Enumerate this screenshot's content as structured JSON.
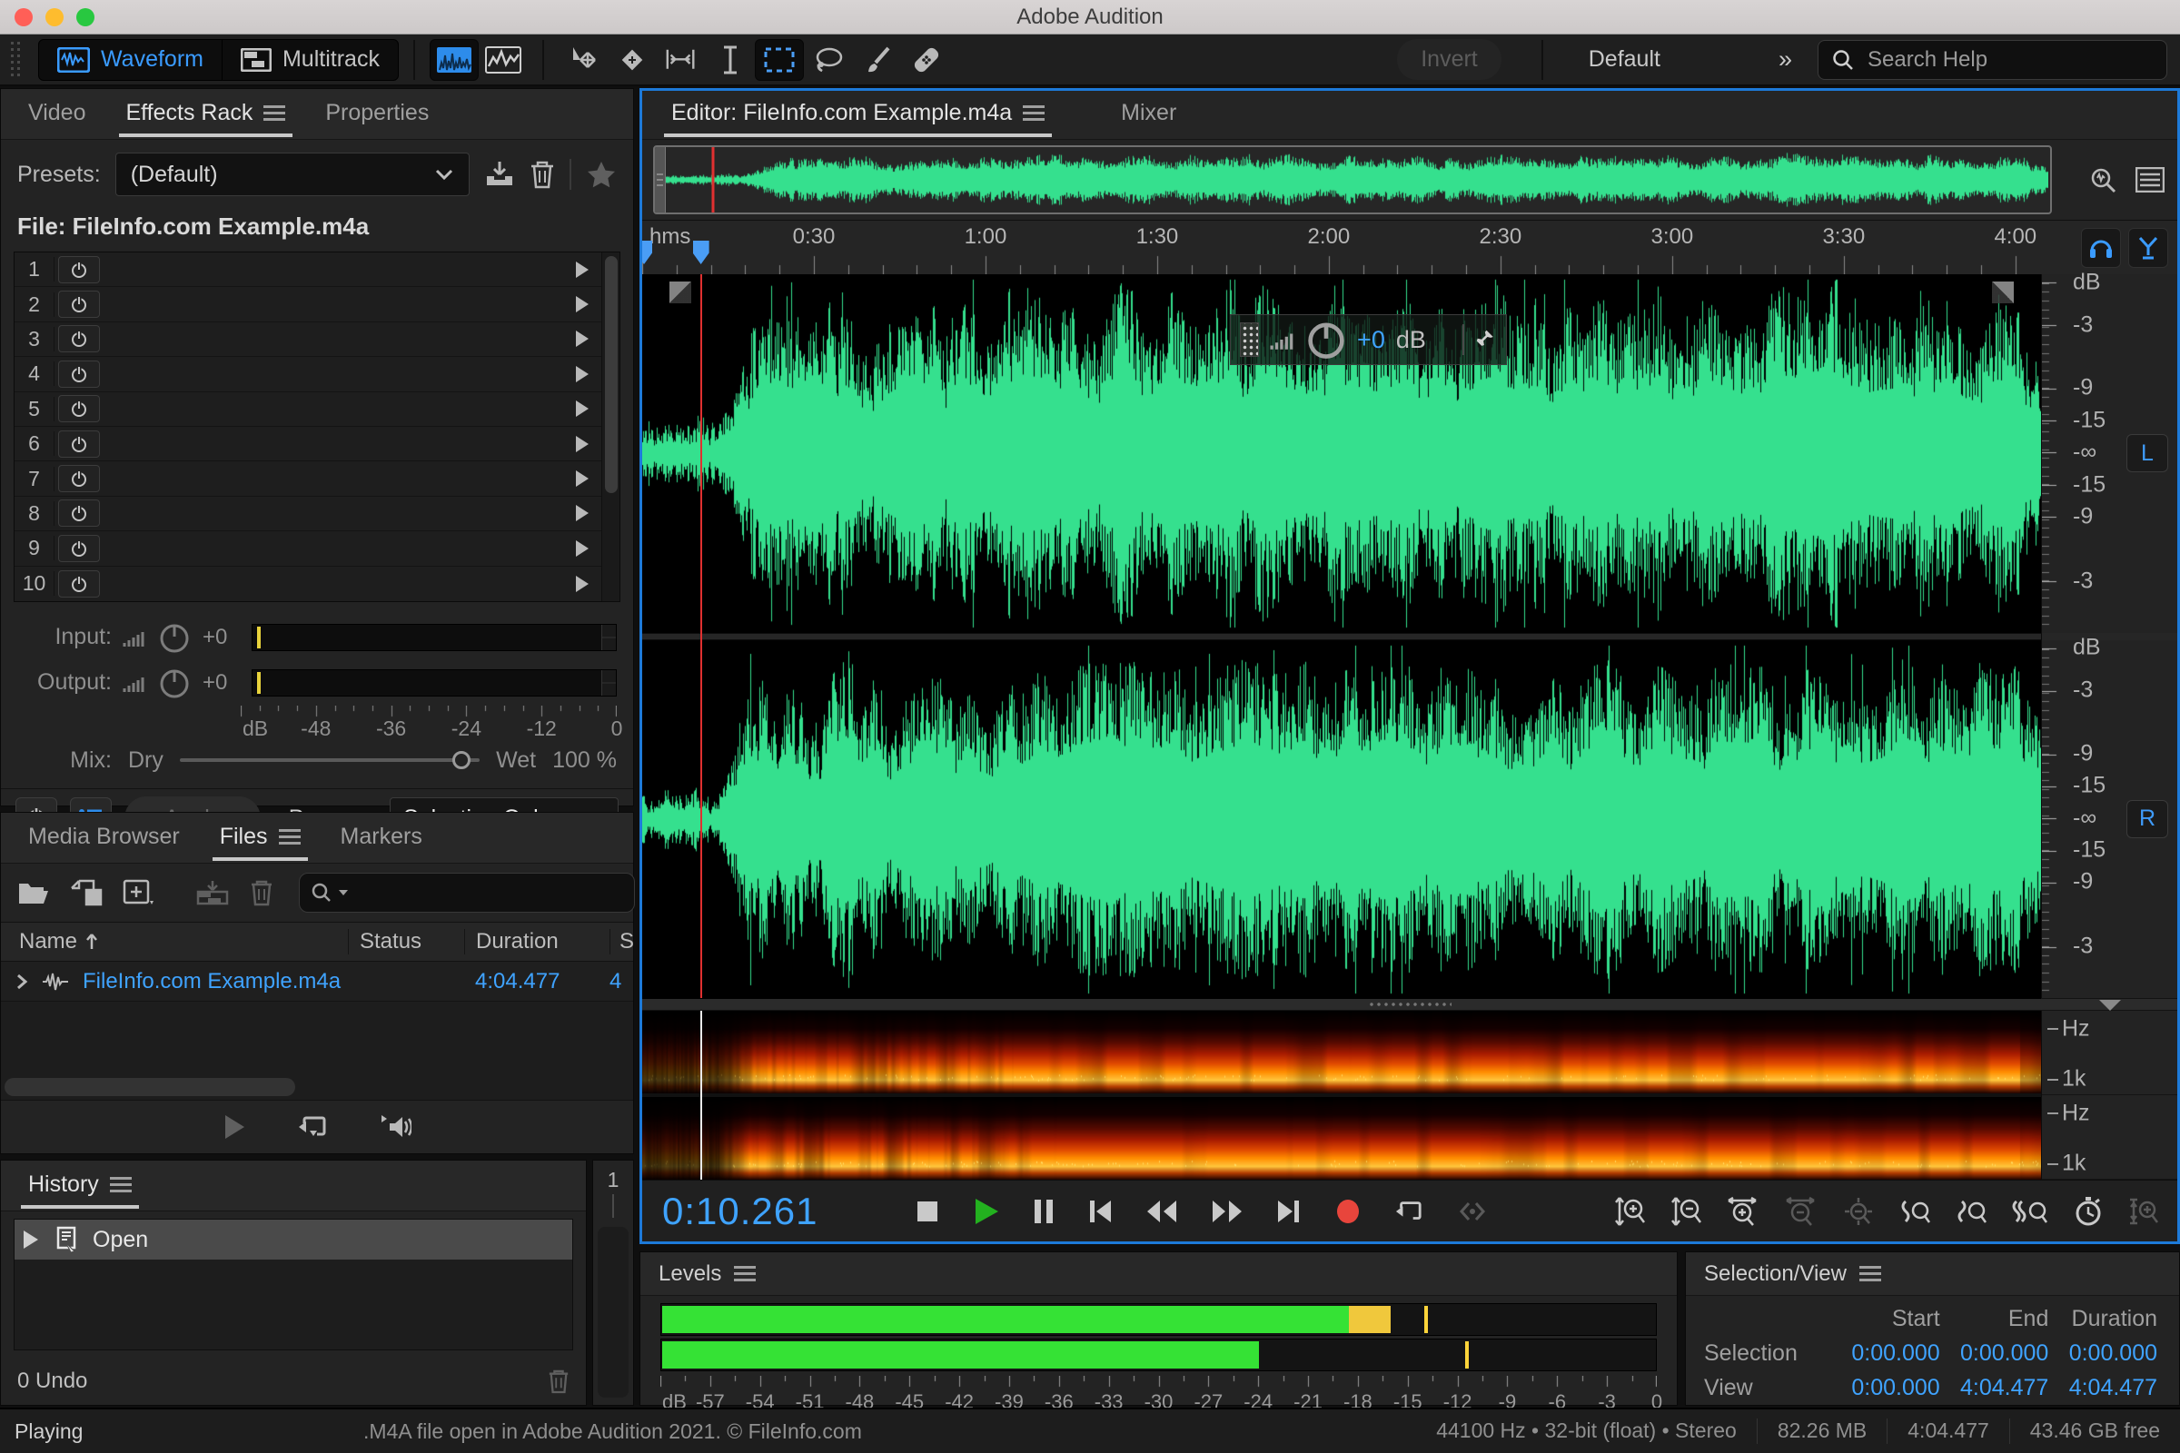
{
  "window": {
    "title": "Adobe Audition"
  },
  "toolbar": {
    "waveform_label": "Waveform",
    "multitrack_label": "Multitrack",
    "invert_label": "Invert",
    "workspace_label": "Default",
    "workspace_more": "»",
    "search_placeholder": "Search Help"
  },
  "effects_panel": {
    "tabs": [
      "Video",
      "Effects Rack",
      "Properties"
    ],
    "presets_label": "Presets:",
    "preset_value": "(Default)",
    "file_label": "File: FileInfo.com Example.m4a",
    "slots": [
      "1",
      "2",
      "3",
      "4",
      "5",
      "6",
      "7",
      "8",
      "9",
      "10"
    ],
    "input_label": "Input:",
    "input_value": "+0",
    "output_label": "Output:",
    "output_value": "+0",
    "meter_scale": [
      "dB",
      "-48",
      "-36",
      "-24",
      "-12",
      "0"
    ],
    "mix_label": "Mix:",
    "dry_label": "Dry",
    "wet_label": "Wet",
    "mix_value": "100 %",
    "apply_label": "Apply",
    "process_label": "Process:",
    "process_value": "Selection Only"
  },
  "files_panel": {
    "tabs": [
      "Media Browser",
      "Files",
      "Markers"
    ],
    "columns": [
      "Name",
      "Status",
      "Duration",
      "S"
    ],
    "rows": [
      {
        "name": "FileInfo.com Example.m4a",
        "status": "",
        "duration": "4:04.477",
        "sample": "4"
      }
    ]
  },
  "history_panel": {
    "title": "History",
    "items": [
      {
        "label": "Open"
      }
    ],
    "undo_label": "0 Undo",
    "strip_label": "1"
  },
  "editor": {
    "tab_label": "Editor: FileInfo.com Example.m4a",
    "mixer_tab_label": "Mixer",
    "ruler_unit": "hms",
    "ruler_ticks": [
      "0:30",
      "1:00",
      "1:30",
      "2:00",
      "2:30",
      "3:00",
      "3:30",
      "4:00"
    ],
    "view_duration_seconds": 244.477,
    "playhead_seconds": 10.261,
    "hud": {
      "value": "+0",
      "unit": "dB"
    },
    "db_scale": [
      "dB",
      "-3",
      "-9",
      "-15",
      "-∞",
      "-15",
      "-9",
      "-3"
    ],
    "channels": [
      "L",
      "R"
    ],
    "freq_scale": [
      "Hz",
      "1k"
    ],
    "timecode": "0:10.261",
    "waveform_color": "#35e08e"
  },
  "levels_panel": {
    "title": "Levels",
    "scale": [
      "dB",
      "-57",
      "-54",
      "-51",
      "-48",
      "-45",
      "-42",
      "-39",
      "-36",
      "-33",
      "-30",
      "-27",
      "-24",
      "-21",
      "-18",
      "-15",
      "-12",
      "-9",
      "-6",
      "-3",
      "0"
    ],
    "meters": {
      "left": {
        "green_to_db": -18.5,
        "yellow_to_db": -16,
        "peak_db": -14
      },
      "right": {
        "green_to_db": -24,
        "yellow_to_db": null,
        "peak_db": -11.5
      }
    }
  },
  "selection_view_panel": {
    "title": "Selection/View",
    "columns": [
      "Start",
      "End",
      "Duration"
    ],
    "rows": [
      {
        "label": "Selection",
        "start": "0:00.000",
        "end": "0:00.000",
        "duration": "0:00.000"
      },
      {
        "label": "View",
        "start": "0:00.000",
        "end": "4:04.477",
        "duration": "4:04.477"
      }
    ]
  },
  "status_bar": {
    "left": "Playing",
    "center": ".M4A file open in Adobe Audition 2021. © FileInfo.com",
    "format": "44100 Hz • 32-bit (float) • Stereo",
    "size": "82.26 MB",
    "duration": "4:04.477",
    "free": "43.46 GB free"
  }
}
